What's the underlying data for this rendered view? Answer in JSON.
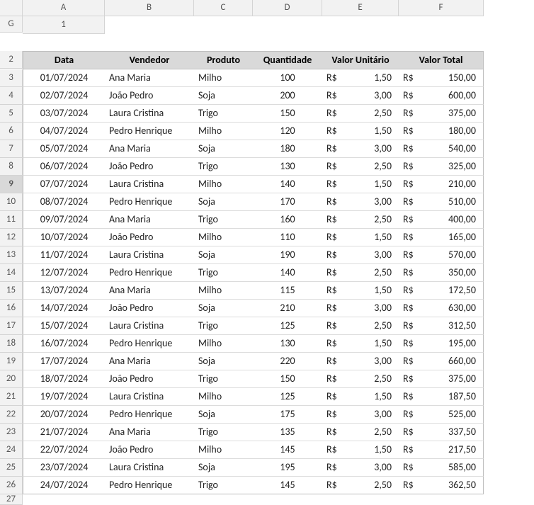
{
  "columns": [
    "A",
    "B",
    "C",
    "D",
    "E",
    "F",
    "G"
  ],
  "headers": {
    "b": "Data",
    "c": "Vendedor",
    "d": "Produto",
    "e": "Quantidade",
    "f": "Valor Unitário",
    "g": "Valor Total"
  },
  "currency": "R$",
  "rows": [
    {
      "r": "3",
      "data": "01/07/2024",
      "vend": "Ana Maria",
      "prod": "Milho",
      "qtd": "100",
      "vu": "1,50",
      "vt": "150,00"
    },
    {
      "r": "4",
      "data": "02/07/2024",
      "vend": "João Pedro",
      "prod": "Soja",
      "qtd": "200",
      "vu": "3,00",
      "vt": "600,00"
    },
    {
      "r": "5",
      "data": "03/07/2024",
      "vend": "Laura Cristina",
      "prod": "Trigo",
      "qtd": "150",
      "vu": "2,50",
      "vt": "375,00"
    },
    {
      "r": "6",
      "data": "04/07/2024",
      "vend": "Pedro Henrique",
      "prod": "Milho",
      "qtd": "120",
      "vu": "1,50",
      "vt": "180,00"
    },
    {
      "r": "7",
      "data": "05/07/2024",
      "vend": "Ana Maria",
      "prod": "Soja",
      "qtd": "180",
      "vu": "3,00",
      "vt": "540,00"
    },
    {
      "r": "8",
      "data": "06/07/2024",
      "vend": "João Pedro",
      "prod": "Trigo",
      "qtd": "130",
      "vu": "2,50",
      "vt": "325,00"
    },
    {
      "r": "9",
      "data": "07/07/2024",
      "vend": "Laura Cristina",
      "prod": "Milho",
      "qtd": "140",
      "vu": "1,50",
      "vt": "210,00"
    },
    {
      "r": "10",
      "data": "08/07/2024",
      "vend": "Pedro Henrique",
      "prod": "Soja",
      "qtd": "170",
      "vu": "3,00",
      "vt": "510,00"
    },
    {
      "r": "11",
      "data": "09/07/2024",
      "vend": "Ana Maria",
      "prod": "Trigo",
      "qtd": "160",
      "vu": "2,50",
      "vt": "400,00"
    },
    {
      "r": "12",
      "data": "10/07/2024",
      "vend": "João Pedro",
      "prod": "Milho",
      "qtd": "110",
      "vu": "1,50",
      "vt": "165,00"
    },
    {
      "r": "13",
      "data": "11/07/2024",
      "vend": "Laura Cristina",
      "prod": "Soja",
      "qtd": "190",
      "vu": "3,00",
      "vt": "570,00"
    },
    {
      "r": "14",
      "data": "12/07/2024",
      "vend": "Pedro Henrique",
      "prod": "Trigo",
      "qtd": "140",
      "vu": "2,50",
      "vt": "350,00"
    },
    {
      "r": "15",
      "data": "13/07/2024",
      "vend": "Ana Maria",
      "prod": "Milho",
      "qtd": "115",
      "vu": "1,50",
      "vt": "172,50"
    },
    {
      "r": "16",
      "data": "14/07/2024",
      "vend": "João Pedro",
      "prod": "Soja",
      "qtd": "210",
      "vu": "3,00",
      "vt": "630,00"
    },
    {
      "r": "17",
      "data": "15/07/2024",
      "vend": "Laura Cristina",
      "prod": "Trigo",
      "qtd": "125",
      "vu": "2,50",
      "vt": "312,50"
    },
    {
      "r": "18",
      "data": "16/07/2024",
      "vend": "Pedro Henrique",
      "prod": "Milho",
      "qtd": "130",
      "vu": "1,50",
      "vt": "195,00"
    },
    {
      "r": "19",
      "data": "17/07/2024",
      "vend": "Ana Maria",
      "prod": "Soja",
      "qtd": "220",
      "vu": "3,00",
      "vt": "660,00"
    },
    {
      "r": "20",
      "data": "18/07/2024",
      "vend": "João Pedro",
      "prod": "Trigo",
      "qtd": "150",
      "vu": "2,50",
      "vt": "375,00"
    },
    {
      "r": "21",
      "data": "19/07/2024",
      "vend": "Laura Cristina",
      "prod": "Milho",
      "qtd": "125",
      "vu": "1,50",
      "vt": "187,50"
    },
    {
      "r": "22",
      "data": "20/07/2024",
      "vend": "Pedro Henrique",
      "prod": "Soja",
      "qtd": "175",
      "vu": "3,00",
      "vt": "525,00"
    },
    {
      "r": "23",
      "data": "21/07/2024",
      "vend": "Ana Maria",
      "prod": "Trigo",
      "qtd": "135",
      "vu": "2,50",
      "vt": "337,50"
    },
    {
      "r": "24",
      "data": "22/07/2024",
      "vend": "João Pedro",
      "prod": "Milho",
      "qtd": "145",
      "vu": "1,50",
      "vt": "217,50"
    },
    {
      "r": "25",
      "data": "23/07/2024",
      "vend": "Laura Cristina",
      "prod": "Soja",
      "qtd": "195",
      "vu": "3,00",
      "vt": "585,00"
    },
    {
      "r": "26",
      "data": "24/07/2024",
      "vend": "Pedro Henrique",
      "prod": "Trigo",
      "qtd": "145",
      "vu": "2,50",
      "vt": "362,50"
    }
  ],
  "selectedRow": "9",
  "rowLabels": {
    "r1": "1",
    "r2": "2",
    "r27": "27"
  }
}
